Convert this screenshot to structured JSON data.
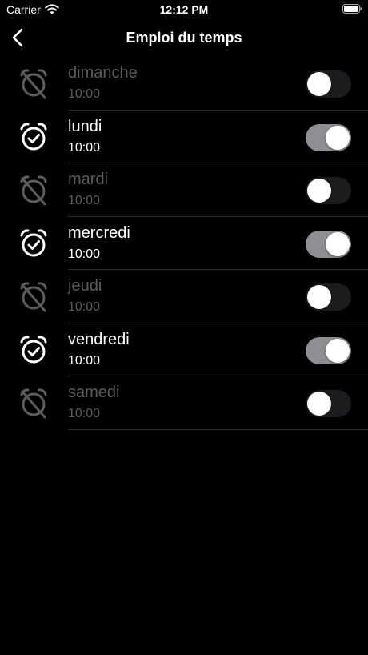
{
  "status_bar": {
    "carrier": "Carrier",
    "time": "12:12 PM"
  },
  "nav": {
    "title": "Emploi du temps",
    "back_icon": "chevron-left-icon"
  },
  "colors": {
    "on_text": "#ffffff",
    "off_text": "#5c5c5e",
    "toggle_on": "#8e8e93",
    "toggle_off": "#1c1c1e"
  },
  "days": [
    {
      "day": "dimanche",
      "time": "10:00",
      "enabled": false,
      "icon": "alarm-off-icon"
    },
    {
      "day": "lundi",
      "time": "10:00",
      "enabled": true,
      "icon": "alarm-check-icon"
    },
    {
      "day": "mardi",
      "time": "10:00",
      "enabled": false,
      "icon": "alarm-off-icon"
    },
    {
      "day": "mercredi",
      "time": "10:00",
      "enabled": true,
      "icon": "alarm-check-icon"
    },
    {
      "day": "jeudi",
      "time": "10:00",
      "enabled": false,
      "icon": "alarm-off-icon"
    },
    {
      "day": "vendredi",
      "time": "10:00",
      "enabled": true,
      "icon": "alarm-check-icon"
    },
    {
      "day": "samedi",
      "time": "10:00",
      "enabled": false,
      "icon": "alarm-off-icon"
    }
  ]
}
